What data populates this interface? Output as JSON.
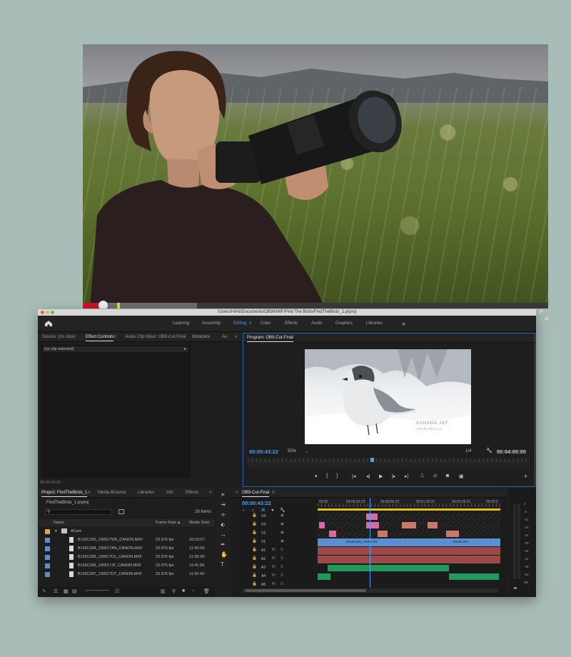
{
  "window_title": "/Users/HAN/Documents/OB9/NWF/Find The Birds/FindTheBirds_1.prproj",
  "workspaces": [
    "Learning",
    "Assembly",
    "Editing",
    "Color",
    "Effects",
    "Audio",
    "Graphics",
    "Libraries"
  ],
  "active_workspace": "Editing",
  "source_panel": {
    "tabs": [
      "Source: (no clips)",
      "Effect Controls",
      "Audio Clip Mixer: OB9-Cut-Final",
      "Metadata",
      "Au"
    ],
    "no_clip_label": "(no clip selected)",
    "timecode": "00:00:43:22"
  },
  "program_monitor": {
    "title": "Program: OB9-Cut-Final",
    "caption_title": "CANADA JAY",
    "caption_sub": "ADAM DIALLA",
    "timecode": "00:00:43:22",
    "zoom": "50%",
    "resolution": "1/4",
    "duration": "00:04:00:00"
  },
  "project_panel": {
    "tabs": [
      "Project: FindTheBirds_1",
      "Media Browser",
      "Libraries",
      "Info",
      "Effects"
    ],
    "project_file": "FindTheBirds_1.prproj",
    "item_count": "28 Items",
    "columns": [
      "Name",
      "Frame Rate",
      "Media Start"
    ],
    "folder": "ACam",
    "rows": [
      {
        "name": "B116C393_190517W5_CANON.MXF",
        "fps": "23.976 fps",
        "start": "10:20:07:"
      },
      {
        "name": "B116C394_190517AN_CANON.MXF",
        "fps": "23.976 fps",
        "start": "11:39:09:"
      },
      {
        "name": "B116C395_190517D1_CANON.MXF",
        "fps": "23.976 fps",
        "start": "11:39:39:"
      },
      {
        "name": "B116C396_190517JF_CANON.MXF",
        "fps": "23.976 fps",
        "start": "11:41:56:"
      },
      {
        "name": "B116C397_190517DT_CANON.MXF",
        "fps": "23.976 fps",
        "start": "11:42:42:"
      }
    ]
  },
  "timeline": {
    "sequence": "OB9-Cut-Final",
    "timecode": "00:00:43:22",
    "ruler_labels": [
      "00:00",
      "00:00:29:23",
      "00:00:59:22",
      "00:01:29:21",
      "00:01:59:21",
      "00:02:2"
    ],
    "video_tracks": [
      "V4",
      "V3",
      "V2",
      "V1"
    ],
    "audio_tracks": [
      "A1",
      "A2",
      "A3",
      "A4",
      "A5",
      "A6"
    ],
    "clip_label": "B116C395_190517D1",
    "clip_label_2": "B116C403"
  },
  "meter_scale": [
    "0",
    "-6",
    "-12",
    "-18",
    "-24",
    "-30",
    "-36",
    "-42",
    "-48",
    "-54",
    "dB"
  ],
  "colors": {
    "accent": "#4e9ff6",
    "audio_clip": "#1f9a5b",
    "video_clip": "#5a8fd1",
    "pink_clip": "#d56aa6",
    "red_clip": "#9b4a4a"
  }
}
